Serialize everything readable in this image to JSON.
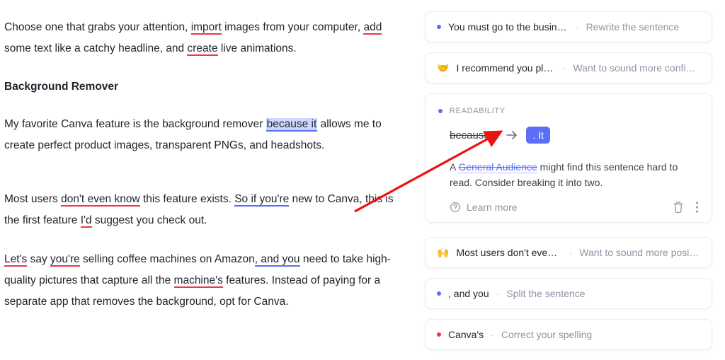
{
  "doc": {
    "p1_a": "Choose one that grabs your attention, ",
    "p1_import": "import",
    "p1_b": " images from your computer, ",
    "p1_add": "add",
    "p1_c": " some text like a catchy headline, and ",
    "p1_create": "create",
    "p1_d": " live animations.",
    "h1": "Background Remover",
    "p2_a": "My favorite Canva feature is the background remover ",
    "p2_because": "because it",
    "p2_b": " allows me to create perfect product images, transparent PNGs, and headshots.",
    "p3_a": "Most users ",
    "p3_dont": "don't even know",
    "p3_b": " this feature exists. ",
    "p3_soif": "So if you're",
    "p3_c": " new to Canva, this is the first feature ",
    "p3_id": "I'd",
    "p3_d": " suggest you check out.",
    "p4_lets": "Let's",
    "p4_a": " say ",
    "p4_youre": "you're",
    "p4_b": " selling coffee machines on Amazon",
    "p4_andyou": ", and you",
    "p4_c": " need to take high-quality pictures that capture all the ",
    "p4_mach": "machine's",
    "p4_d": " features. Instead of paying for a separate app that removes the background, opt for Canva."
  },
  "cards": {
    "c0": {
      "title": "You must go to the business car…",
      "hint": "Rewrite the sentence"
    },
    "c1": {
      "emoji": "🤝",
      "title": "I recommend you play…",
      "hint": "Want to sound more confident?"
    },
    "c2": {
      "category": "READABILITY",
      "strike": "because it",
      "chip": ". It",
      "body_a": "A ",
      "body_link": "General Audience",
      "body_b": " might find this sentence hard to read. Consider breaking it into two.",
      "learn": "Learn more"
    },
    "c3": {
      "emoji": "🙌",
      "title": "Most users don't even k…",
      "hint": "Want to sound more positive?"
    },
    "c4": {
      "title": ", and you",
      "hint": "Split the sentence"
    },
    "c5": {
      "title": "Canva's",
      "hint": "Correct your spelling"
    }
  }
}
